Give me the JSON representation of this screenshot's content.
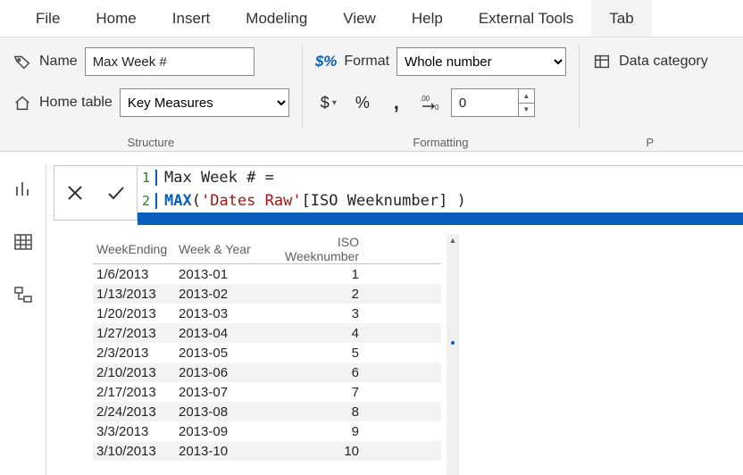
{
  "menu": {
    "file": "File",
    "home": "Home",
    "insert": "Insert",
    "modeling": "Modeling",
    "view": "View",
    "help": "Help",
    "external": "External Tools",
    "tab": "Tab"
  },
  "structure": {
    "nameLabel": "Name",
    "nameValue": "Max Week #",
    "homeTableLabel": "Home table",
    "homeTableValue": "Key Measures",
    "groupLabel": "Structure"
  },
  "formatting": {
    "formatLabel": "Format",
    "formatValue": "Whole number",
    "decimalsValue": "0",
    "groupLabel": "Formatting"
  },
  "properties": {
    "dataCategoryLabel": "Data category"
  },
  "formula": {
    "line1": "Max Week # =",
    "line2_kw": "MAX",
    "line2_paren1": "(",
    "line2_str": "'Dates Raw'",
    "line2_rest": "[ISO Weeknumber] ",
    "line2_paren2": ")"
  },
  "table": {
    "headers": {
      "c1": "WeekEnding",
      "c2": "Week & Year",
      "c3": "ISO Weeknumber"
    },
    "rows": [
      {
        "c1": "1/6/2013",
        "c2": "2013-01",
        "c3": "1"
      },
      {
        "c1": "1/13/2013",
        "c2": "2013-02",
        "c3": "2"
      },
      {
        "c1": "1/20/2013",
        "c2": "2013-03",
        "c3": "3"
      },
      {
        "c1": "1/27/2013",
        "c2": "2013-04",
        "c3": "4"
      },
      {
        "c1": "2/3/2013",
        "c2": "2013-05",
        "c3": "5"
      },
      {
        "c1": "2/10/2013",
        "c2": "2013-06",
        "c3": "6"
      },
      {
        "c1": "2/17/2013",
        "c2": "2013-07",
        "c3": "7"
      },
      {
        "c1": "2/24/2013",
        "c2": "2013-08",
        "c3": "8"
      },
      {
        "c1": "3/3/2013",
        "c2": "2013-09",
        "c3": "9"
      },
      {
        "c1": "3/10/2013",
        "c2": "2013-10",
        "c3": "10"
      }
    ]
  }
}
